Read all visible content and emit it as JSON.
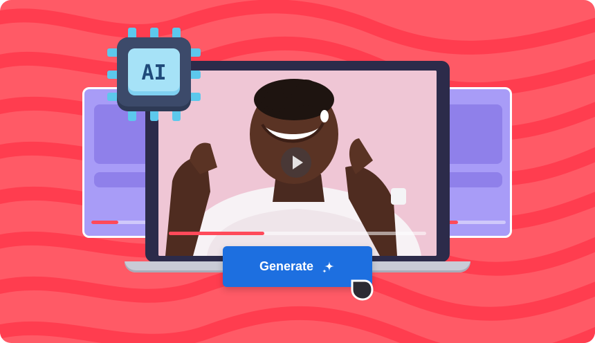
{
  "chip": {
    "label": "AI"
  },
  "video": {
    "progress": 0.37
  },
  "left_card": {
    "progress": 0.45
  },
  "right_card": {
    "progress": 0.2
  },
  "generate_button": {
    "label": "Generate",
    "icon": "sparkle-icon"
  },
  "colors": {
    "background": "#ff5a66",
    "wave": "#ff3d4f",
    "card": "#a89cf7",
    "accent_button": "#1d6fe0",
    "progress": "#ff4a5a",
    "chip": "#2e3a55",
    "chip_face": "#7fd0f0"
  }
}
